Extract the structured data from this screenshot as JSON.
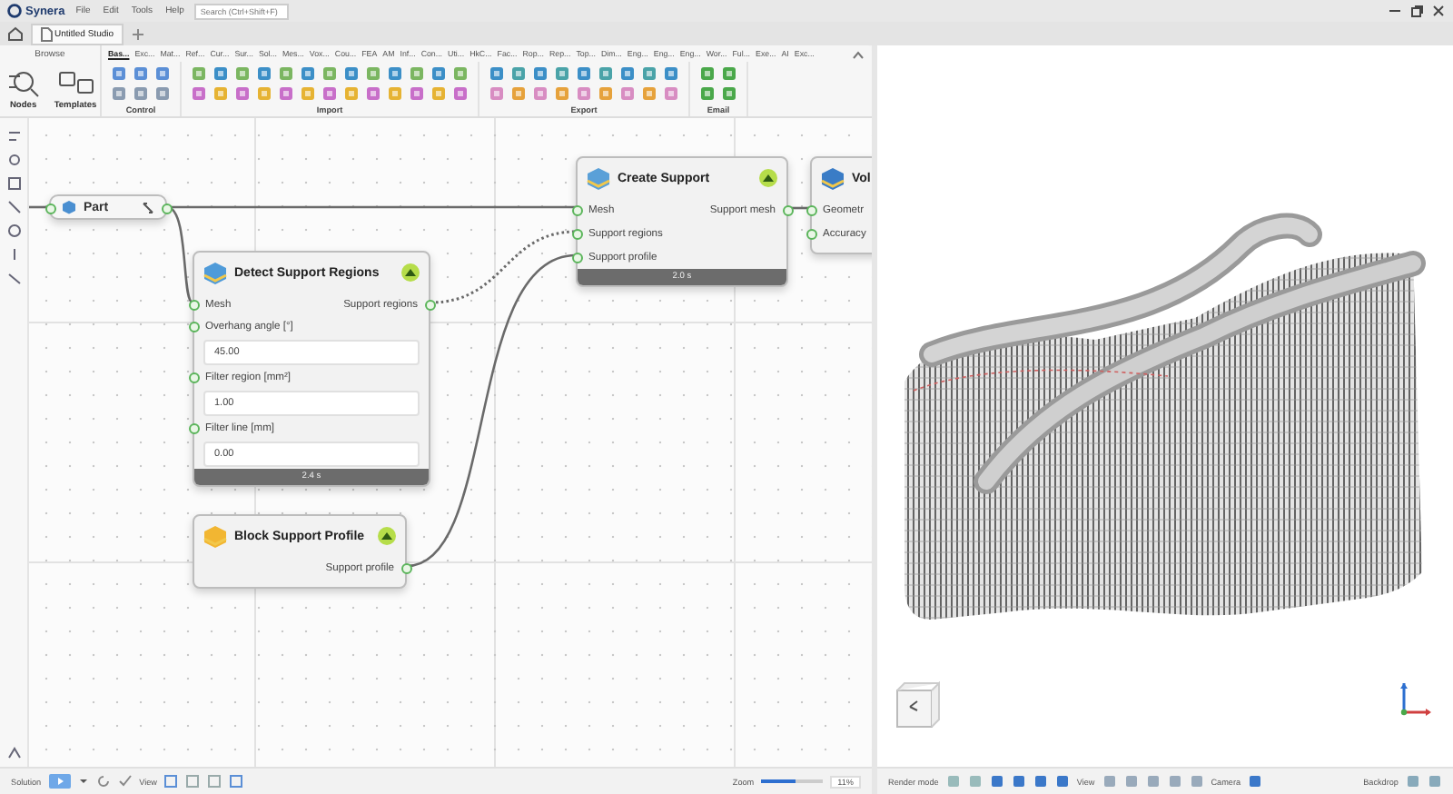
{
  "app": {
    "logo": "Synera",
    "menu": [
      "File",
      "Edit",
      "Tools",
      "Help"
    ],
    "search": {
      "placeholder": "Search (Ctrl+Shift+F)"
    }
  },
  "document_tabs": [
    {
      "label": "Untitled Studio",
      "selected": true
    }
  ],
  "ribbon": {
    "browse": {
      "title": "Browse",
      "items": [
        "Nodes",
        "Templates"
      ]
    },
    "tabs": [
      {
        "label": "Bas...",
        "selected": true
      },
      {
        "label": "Exc...",
        "selected": false
      },
      {
        "label": "Mat...",
        "selected": false
      },
      {
        "label": "Ref...",
        "selected": false
      },
      {
        "label": "Cur...",
        "selected": false
      },
      {
        "label": "Sur...",
        "selected": false
      },
      {
        "label": "Sol...",
        "selected": false
      },
      {
        "label": "Mes...",
        "selected": false
      },
      {
        "label": "Vox...",
        "selected": false
      },
      {
        "label": "Cou...",
        "selected": false
      },
      {
        "label": "FEA",
        "selected": false
      },
      {
        "label": "AM",
        "selected": false
      },
      {
        "label": "Inf...",
        "selected": false
      },
      {
        "label": "Con...",
        "selected": false
      },
      {
        "label": "Uti...",
        "selected": false
      },
      {
        "label": "HkC...",
        "selected": false
      },
      {
        "label": "Fac...",
        "selected": false
      },
      {
        "label": "Rop...",
        "selected": false
      },
      {
        "label": "Rep...",
        "selected": false
      },
      {
        "label": "Top...",
        "selected": false
      },
      {
        "label": "Dim...",
        "selected": false
      },
      {
        "label": "Eng...",
        "selected": false
      },
      {
        "label": "Eng...",
        "selected": false
      },
      {
        "label": "Eng...",
        "selected": false
      },
      {
        "label": "Wor...",
        "selected": false
      },
      {
        "label": "Ful...",
        "selected": false
      },
      {
        "label": "Exe...",
        "selected": false
      },
      {
        "label": "AI",
        "selected": false
      },
      {
        "label": "Exc...",
        "selected": false
      }
    ],
    "groups": [
      "Control",
      "Import",
      "Export",
      "Email"
    ]
  },
  "nodes": [
    {
      "kind": "part",
      "title": "Part"
    },
    {
      "kind": "component",
      "title": "Create Support",
      "rows": [
        {
          "input": "Mesh",
          "output": "Support mesh"
        },
        {
          "input": "Support regions"
        },
        {
          "input": "Support profile"
        }
      ],
      "time": "2.0 s"
    },
    {
      "kind": "component",
      "title": "Detect Support Regions",
      "rows": [
        {
          "input": "Mesh",
          "output": "Support regions"
        }
      ],
      "params": [
        {
          "label": "Overhang angle [°]",
          "value": "45.00"
        },
        {
          "label": "Filter region [mm²]",
          "value": "1.00"
        },
        {
          "label": "Filter line [mm]",
          "value": "0.00"
        }
      ],
      "time": "2.4 s"
    },
    {
      "kind": "component",
      "title": "Block Support Profile",
      "rows": [
        {
          "output": "Support profile"
        }
      ]
    },
    {
      "kind": "component",
      "title": "Vol",
      "rows": [
        {
          "input": "Geometr"
        },
        {
          "input": "Accuracy"
        }
      ]
    }
  ],
  "editor_bar": {
    "solution_label": "Solution",
    "view_label": "View",
    "zoom": {
      "label": "Zoom",
      "level": 0.55,
      "reading": "11%"
    }
  },
  "viewport_bar": {
    "render_label": "Render mode",
    "view_label": "View",
    "camera_label": "Camera",
    "backdrop_label": "Backdrop"
  }
}
